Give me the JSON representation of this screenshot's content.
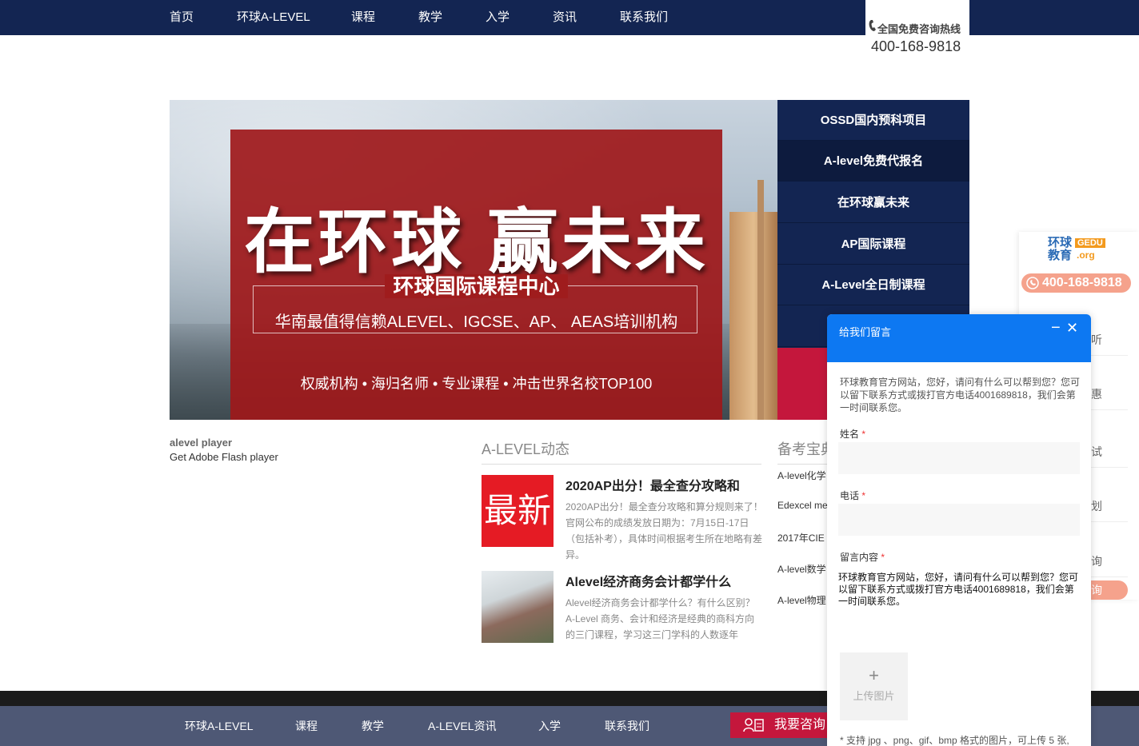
{
  "topnav": {
    "items": [
      "首页",
      "环球A-LEVEL",
      "课程",
      "教学",
      "入学",
      "资讯",
      "联系我们"
    ]
  },
  "hotline": {
    "label": "全国免费咨询热线",
    "number": "400-168-9818"
  },
  "banner": {
    "headline": "在环球  赢未来",
    "subtitle": "环球国际课程中心",
    "tagline": "华南最值得信赖ALEVEL、IGCSE、AP、 AEAS培训机构",
    "slogan": "权威机构 • 海归名师 • 专业课程 • 冲击世界名校TOP100"
  },
  "side_menu": {
    "items": [
      "OSSD国内预科项目",
      "A-level免费代报名",
      "在环球赢未来",
      "AP国际课程",
      "A-Level全日制课程"
    ]
  },
  "flash": {
    "title": "alevel player",
    "link": "Get Adobe Flash player"
  },
  "news": {
    "section_title": "A-LEVEL动态",
    "items": [
      {
        "thumb_text": "最新",
        "title": "2020AP出分！最全查分攻略和",
        "desc": "2020AP出分！最全查分攻略和算分规则来了！官网公布的成绩发放日期为：7月15日-17日（包括补考），具体时间根据考生所在地略有差异。"
      },
      {
        "thumb_text": "",
        "title": "Alevel经济商务会计都学什么",
        "desc": "Alevel经济商务会计都学什么？有什么区别？A-Level 商务、会计和经济是经典的商科方向的三门课程，学习这三门学科的人数逐年"
      }
    ]
  },
  "prep": {
    "section_title": "备考宝典",
    "items": [
      "A-level化学",
      "Edexcel me",
      "2017年CIE",
      "A-level数学",
      "A-level物理"
    ]
  },
  "float_bar": {
    "logo_text": "环球\n教育",
    "logo_badge": "GEDU",
    "logo_domain": ".org",
    "phone": "400-168-9818",
    "items": [
      "听",
      "惠",
      "试",
      "划",
      "询"
    ],
    "pill": "询"
  },
  "chat": {
    "title": "给我们留言",
    "intro": "环球教育官方网站，您好，请问有什么可以帮到您？您可以留下联系方式或拨打官方电话4001689818，我们会第一时间联系您。",
    "name_label": "姓名",
    "phone_label": "电话",
    "message_label": "留言内容",
    "message_value": "环球教育官方网站，您好，请问有什么可以帮到您？您可以留下联系方式或拨打官方电话4001689818，我们会第一时间联系您。",
    "upload_plus": "+",
    "upload_label": "上传图片",
    "note": "* 支持 jpg 、png、gif、bmp 格式的图片，可上传 5 张,",
    "required_mark": "*",
    "minimize": "−",
    "close": "✕"
  },
  "footer": {
    "items": [
      "环球A-LEVEL",
      "课程",
      "教学",
      "A-LEVEL资讯",
      "入学",
      "联系我们"
    ],
    "consult_button": "我要咨询"
  },
  "colors": {
    "nav_bg": "#132552",
    "accent_red": "#c4173c",
    "chat_blue": "#0d78f2",
    "footer_bg": "#4e5875"
  }
}
